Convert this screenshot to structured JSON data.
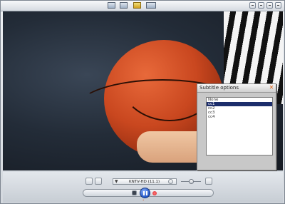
{
  "dialog": {
    "title": "Subtitle options",
    "items": [
      {
        "label": "None",
        "selected": false
      },
      {
        "label": "cc1",
        "selected": true
      },
      {
        "label": "cc2",
        "selected": false
      },
      {
        "label": "cc3",
        "selected": false
      },
      {
        "label": "cc4",
        "selected": false
      }
    ]
  },
  "controls": {
    "channel": "KNTV-HD (11.1)"
  },
  "colors": {
    "selection": "#1c2d6b",
    "play": "#1f53c4",
    "close": "#e06010"
  }
}
